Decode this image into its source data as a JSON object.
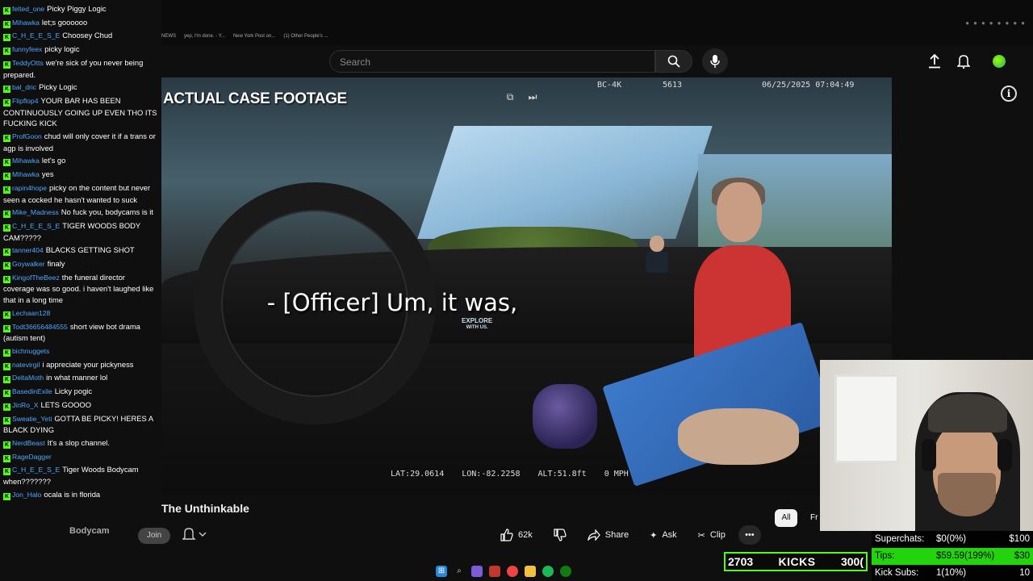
{
  "browser": {
    "bookmarks": [
      "NEWS",
      "yep, I'm done. - Y...",
      "New York Post on...",
      "(1) Other People's ..."
    ]
  },
  "header": {
    "search_placeholder": "Search"
  },
  "video": {
    "case_label": "ACTUAL CASE FOOTAGE",
    "cam_id": "BC-4K",
    "cam_num": "5613",
    "timestamp": "06/25/2025 07:04:49",
    "subtitle": "- [Officer] Um, it was,",
    "watermark_line1": "EXPLORE",
    "watermark_line2": "WITH US.",
    "lat": "LAT:29.0614",
    "lon": "LON:-82.2258",
    "alt": "ALT:51.8ft",
    "speed": "0 MPH"
  },
  "below": {
    "title": "The Unthinkable",
    "channel": "Bodycam",
    "join": "Join",
    "likes": "62k",
    "share": "Share",
    "ask": "Ask",
    "clip": "Clip",
    "filter_all": "All",
    "filter_more": "Fr"
  },
  "chat": [
    {
      "user": "felted_one",
      "text": "Picky Piggy Logic"
    },
    {
      "user": "Mihawka",
      "text": "let;s goooooo"
    },
    {
      "user": "C_H_E_E_S_E",
      "text": "Choosey Chud"
    },
    {
      "user": "funnyfeex",
      "text": "picky logic"
    },
    {
      "user": "TeddyOtts",
      "text": "we're sick of you never being prepared."
    },
    {
      "user": "bal_dric",
      "text": "Picky Logic"
    },
    {
      "user": "Flipflop4",
      "text": "YOUR BAR HAS BEEN CONTINUOUSLY GOING UP EVEN THO ITS FUCKING KICK"
    },
    {
      "user": "ProfGoon",
      "text": "chud will only cover it if a trans or agp is involved"
    },
    {
      "user": "Mihawka",
      "text": "let's go"
    },
    {
      "user": "Mihawka",
      "text": "yes"
    },
    {
      "user": "rapin4hope",
      "text": "picky on the content but never seen a cocked he hasn't wanted to suck"
    },
    {
      "user": "Mike_Madness",
      "text": "No fuck you, bodycams is it"
    },
    {
      "user": "C_H_E_E_S_E",
      "text": "TIGER WOODS BODY CAM?????"
    },
    {
      "user": "tanner404",
      "text": "BLACKS GETTING SHOT"
    },
    {
      "user": "Goywalker",
      "text": "finaly"
    },
    {
      "user": "KingofTheBeez",
      "text": "the funeral director coverage was so good. i haven't laughed like that in a long time"
    },
    {
      "user": "Lechaan128",
      "text": ""
    },
    {
      "user": "Todt36656484555",
      "text": "short view bot drama (autism tent)"
    },
    {
      "user": "bichnuggets",
      "text": ""
    },
    {
      "user": "natevirgil",
      "text": "i appreciate your pickyness"
    },
    {
      "user": "DeltaMoth",
      "text": "in what manner lol"
    },
    {
      "user": "BasedinExile",
      "text": "Licky pogic"
    },
    {
      "user": "JinRo_X",
      "text": "LETS GOOOO"
    },
    {
      "user": "Sweatie_Yeti",
      "text": "GOTTA BE PICKY! HERES A BLACK DYING"
    },
    {
      "user": "NerdBeast",
      "text": "It's a slop channel."
    },
    {
      "user": "RageDagger",
      "text": ""
    },
    {
      "user": "C_H_E_E_S_E",
      "text": "Tiger Woods Bodycam when???????"
    },
    {
      "user": "Jon_Halo",
      "text": "ocala is in florida"
    }
  ],
  "overlay": {
    "kicks_count": "2703",
    "kicks_label": "KICKS",
    "kicks_goal": "300(",
    "superchats_label": "Superchats:",
    "superchats_value": "$0(0%)",
    "superchats_goal": "$100",
    "tips_label": "Tips:",
    "tips_value": "$59.59(199%)",
    "tips_goal": "$30",
    "kicksubs_label": "Kick Subs:",
    "kicksubs_value": "1(10%)",
    "kicksubs_goal": "10"
  },
  "colors": {
    "kick_green": "#53fc18",
    "chat_user": "#4ea8ff",
    "tips_bg": "#22d40c"
  }
}
